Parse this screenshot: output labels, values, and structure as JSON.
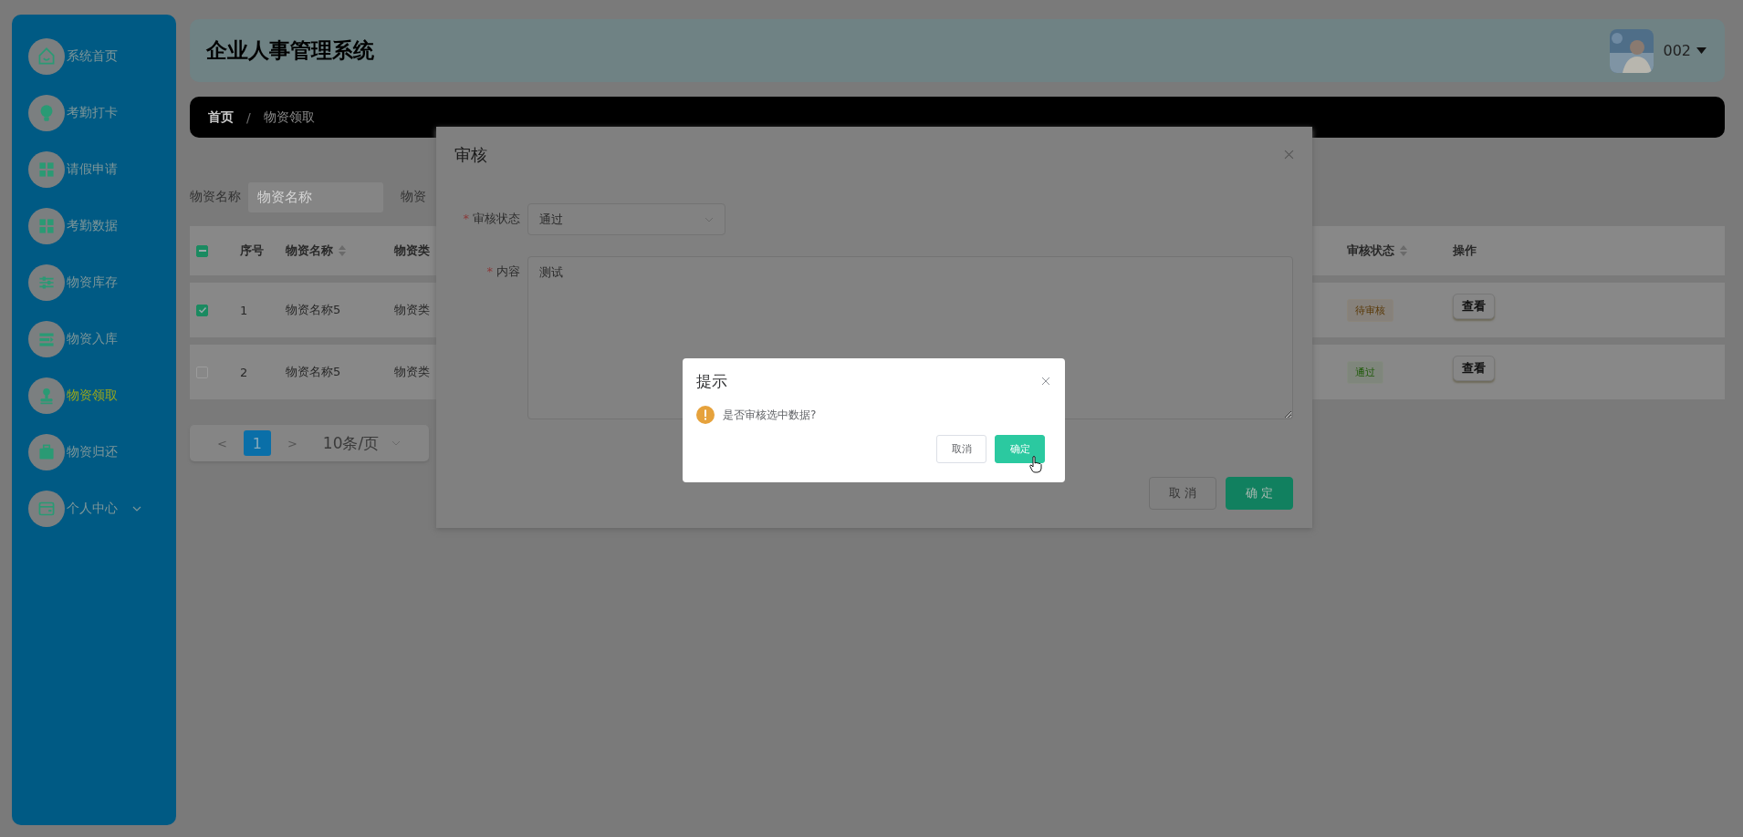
{
  "app_title": "企业人事管理系统",
  "user": {
    "name": "002"
  },
  "sidebar": {
    "items": [
      {
        "label": "系统首页",
        "kind": "home",
        "selected": false,
        "submenu": false
      },
      {
        "label": "考勤打卡",
        "kind": "bulb",
        "selected": false,
        "submenu": false
      },
      {
        "label": "请假申请",
        "kind": "grid",
        "selected": false,
        "submenu": false
      },
      {
        "label": "考勤数据",
        "kind": "grid",
        "selected": false,
        "submenu": false
      },
      {
        "label": "物资库存",
        "kind": "sliders",
        "selected": false,
        "submenu": false
      },
      {
        "label": "物资入库",
        "kind": "list",
        "selected": false,
        "submenu": false
      },
      {
        "label": "物资领取",
        "kind": "stamp",
        "selected": true,
        "submenu": false
      },
      {
        "label": "物资归还",
        "kind": "briefcase",
        "selected": false,
        "submenu": false
      },
      {
        "label": "个人中心",
        "kind": "card",
        "selected": false,
        "submenu": true
      }
    ]
  },
  "breadcrumb": {
    "items": [
      "首页",
      "物资领取"
    ],
    "separator": "/"
  },
  "search": {
    "label": "物资名称",
    "placeholder": "物资名称",
    "label_2": "物资"
  },
  "table": {
    "select_all": {
      "indeterminate": true
    },
    "columns": [
      {
        "label": "序号",
        "sortable": false
      },
      {
        "label": "物资名称",
        "sortable": true
      },
      {
        "label": "物资类",
        "sortable": false
      },
      {
        "label": "审核状态",
        "sortable": true
      },
      {
        "label": "操作",
        "sortable": false
      }
    ],
    "rows": [
      {
        "checked": true,
        "cells": [
          "1",
          "物资名称5",
          "物资类"
        ],
        "status": {
          "label": "待审核",
          "kind": "pending"
        },
        "action": "查看"
      },
      {
        "checked": false,
        "cells": [
          "2",
          "物资名称5",
          "物资类"
        ],
        "status": {
          "label": "通过",
          "kind": "passed"
        },
        "action": "查看"
      }
    ]
  },
  "pagination": {
    "prev": "<",
    "next": ">",
    "pages": [
      {
        "label": "1",
        "selected": true
      }
    ],
    "page_size": "10条/页"
  },
  "review_dialog": {
    "title": "审核",
    "required_mark": "*",
    "fields": [
      {
        "label": "审核状态",
        "required": true,
        "kind": "select",
        "value": "通过"
      },
      {
        "label": "内容",
        "required": true,
        "kind": "textarea",
        "value": "测试"
      }
    ],
    "buttons": [
      {
        "label": "取 消",
        "kind": "default"
      },
      {
        "label": "确 定",
        "kind": "primary"
      }
    ]
  },
  "confirm_dialog": {
    "title": "提示",
    "message": "是否审核选中数据?",
    "buttons": [
      {
        "label": "取消",
        "kind": "default"
      },
      {
        "label": "确定",
        "kind": "primary"
      }
    ]
  }
}
